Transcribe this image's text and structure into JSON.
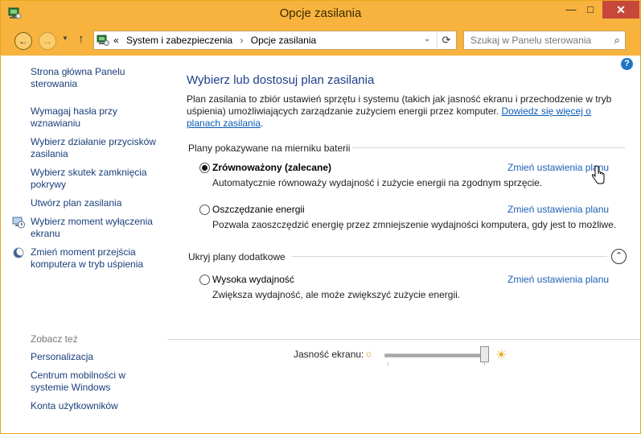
{
  "window": {
    "title": "Opcje zasilania",
    "minimize_glyph": "—",
    "maximize_glyph": "□",
    "close_glyph": "✕"
  },
  "nav": {
    "back_glyph": "←",
    "forward_glyph": "→",
    "recent_glyph": "▼",
    "up_glyph": "↑",
    "breadcrumb": {
      "prefix": "«",
      "items": [
        "System i zabezpieczenia",
        "Opcje zasilania"
      ],
      "separator": "›"
    },
    "dropdown_glyph": "⌄",
    "refresh_glyph": "⟳",
    "search_placeholder": "Szukaj w Panelu sterowania",
    "search_glyph": "⌕"
  },
  "help_glyph": "?",
  "sidebar": {
    "items": [
      {
        "label": "Strona główna Panelu sterowania"
      },
      {
        "label": "Wymagaj hasła przy wznawianiu"
      },
      {
        "label": "Wybierz działanie przycisków zasilania"
      },
      {
        "label": "Wybierz skutek zamknięcia pokrywy"
      },
      {
        "label": "Utwórz plan zasilania"
      },
      {
        "label": "Wybierz moment wyłączenia ekranu",
        "icon": "monitor-clock-icon"
      },
      {
        "label": "Zmień moment przejścia komputera w tryb uśpienia",
        "icon": "moon-icon"
      }
    ],
    "see_also_heading": "Zobacz też",
    "see_also": [
      {
        "label": "Personalizacja"
      },
      {
        "label": "Centrum mobilności w systemie Windows"
      },
      {
        "label": "Konta użytkowników"
      }
    ]
  },
  "main": {
    "heading": "Wybierz lub dostosuj plan zasilania",
    "description": "Plan zasilania to zbiór ustawień sprzętu i systemu (takich jak jasność ekranu i przechodzenie w tryb uśpienia) umożliwiających zarządzanie zużyciem energii przez komputer. ",
    "learn_more_link": "Dowiedz się więcej o planach zasilania",
    "description_end": ".",
    "battery_group": {
      "heading": "Plany pokazywane na mierniku baterii",
      "plans": [
        {
          "name": "Zrównoważony (zalecane)",
          "selected": true,
          "link": "Zmień ustawienia planu",
          "description": "Automatycznie równoważy wydajność i zużycie energii na zgodnym sprzęcie."
        },
        {
          "name": "Oszczędzanie energii",
          "selected": false,
          "link": "Zmień ustawienia planu",
          "description": "Pozwala zaoszczędzić energię przez zmniejszenie wydajności komputera, gdy jest to możliwe."
        }
      ]
    },
    "additional_group": {
      "heading": "Ukryj plany dodatkowe",
      "collapse_glyph": "⌃",
      "plans": [
        {
          "name": "Wysoka wydajność",
          "selected": false,
          "link": "Zmień ustawienia planu",
          "description": "Zwiększa wydajność, ale może zwiększyć zużycie energii."
        }
      ]
    }
  },
  "footer": {
    "brightness_label": "Jasność ekranu:",
    "brightness_low_glyph": "☼",
    "brightness_high_glyph": "☀",
    "brightness_level": 0.97
  },
  "colors": {
    "titlebar": "#f7b33d",
    "link": "#1e5fb5",
    "heading": "#1e3f8a"
  }
}
